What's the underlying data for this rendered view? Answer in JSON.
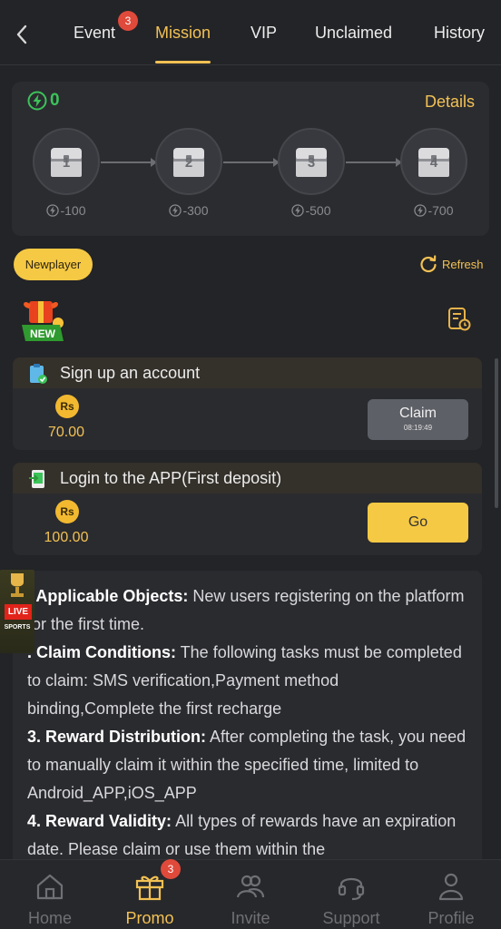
{
  "nav": {
    "tabs": [
      {
        "label": "Event",
        "badge": "3"
      },
      {
        "label": "Mission",
        "active": true
      },
      {
        "label": "VIP"
      },
      {
        "label": "Unclaimed"
      },
      {
        "label": "History"
      }
    ]
  },
  "progress": {
    "energy": "0",
    "details_label": "Details",
    "chests": [
      {
        "number": "1",
        "cost": "-100"
      },
      {
        "number": "2",
        "cost": "-300"
      },
      {
        "number": "3",
        "cost": "-500"
      },
      {
        "number": "4",
        "cost": "-700"
      }
    ]
  },
  "filter": {
    "category_label": "Newplayer",
    "refresh_label": "Refresh"
  },
  "new_badge_label": "NEW",
  "tasks": [
    {
      "title": "Sign up an account",
      "currency": "Rs",
      "amount": "70.00",
      "button_label": "Claim",
      "timer": "08:19:49"
    },
    {
      "title": "Login to the APP(First deposit)",
      "currency": "Rs",
      "amount": "100.00",
      "button_label": "Go"
    }
  ],
  "rules": [
    {
      "heading": ". Applicable Objects:",
      "text": " New users registering on the platform for the first time."
    },
    {
      "heading": ". Claim Conditions:",
      "text": " The following tasks must be completed to claim: SMS verification,Payment method binding,Complete the first recharge"
    },
    {
      "heading": "3. Reward Distribution:",
      "text": " After completing the task, you need to manually claim it within the specified time, limited to Android_APP,iOS_APP"
    },
    {
      "heading": "4. Reward Validity:",
      "text": " All types of rewards have an expiration date. Please claim or use them within the"
    }
  ],
  "ad": {
    "live_label": "LIVE",
    "sports_label": "SPORTS"
  },
  "bottom_nav": {
    "items": [
      {
        "label": "Home",
        "icon": "home-icon"
      },
      {
        "label": "Promo",
        "icon": "gift-icon",
        "badge": "3",
        "active": true
      },
      {
        "label": "Invite",
        "icon": "people-icon"
      },
      {
        "label": "Support",
        "icon": "headset-icon"
      },
      {
        "label": "Profile",
        "icon": "user-icon"
      }
    ]
  },
  "colors": {
    "accent": "#f2c154",
    "energy": "#3cc35a",
    "badge": "#e04a3b",
    "background": "#232427"
  }
}
